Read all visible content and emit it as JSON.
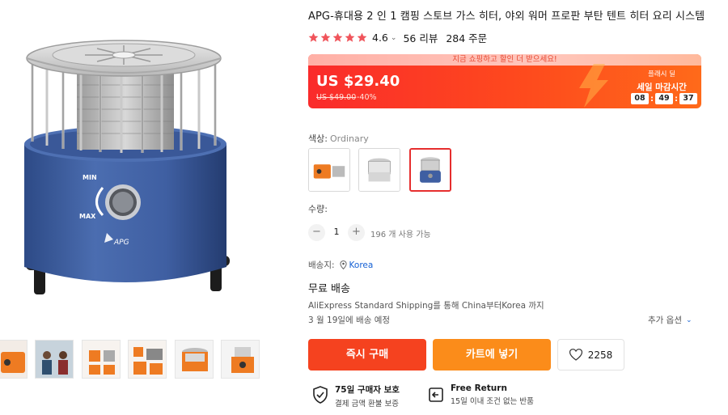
{
  "product": {
    "title": "APG-휴대용 2 인 1 캠핑 스토브 가스 히터, 야외 워머 프로판 부탄 텐트 히터 요리 시스템",
    "rating": "4.6",
    "stars": 5,
    "reviews": "56 리뷰",
    "orders": "284 주문"
  },
  "price": {
    "promo_banner": "지금 쇼핑하고 할인 더 받으세요!",
    "current": "US $29.40",
    "original": "US $49.00",
    "discount": "-40%",
    "flash_label": "플래시 딜",
    "flash_title": "세일 마감시간",
    "timer": {
      "h": "08",
      "m": "49",
      "s": "37"
    },
    "colors": {
      "start": "#fa2b2b",
      "end": "#ff6a1a"
    }
  },
  "color": {
    "label": "색상:",
    "selected": "Ordinary",
    "options": [
      "orange-heater",
      "silver-heater",
      "blue-heater"
    ]
  },
  "quantity": {
    "label": "수량:",
    "value": "1",
    "minus": "−",
    "plus": "+",
    "available": "196 개 사용 가능"
  },
  "shipping": {
    "label": "배송지:",
    "country": "Korea",
    "free": "무료 배송",
    "method": "AliExpress Standard Shipping를 통해 China부터Korea 까지",
    "date": "3 월 19일에 배송 예정",
    "more_options": "추가 옵션"
  },
  "actions": {
    "buy_now": "즉시 구매",
    "add_to_cart": "카트에 넣기",
    "wishlist_count": "2258"
  },
  "guarantees": [
    {
      "title": "75일 구매자 보호",
      "subtitle": "결제 금액 환불 보증",
      "icon": "shield-check-icon"
    },
    {
      "title": "Free Return",
      "subtitle": "15일 이내 조건 없는 반품",
      "icon": "return-icon"
    }
  ],
  "gallery": {
    "main_image": "blue-heater-photo",
    "heater_labels": {
      "min": "MIN",
      "max": "MAX",
      "brand": "APG"
    },
    "thumbnails": [
      "orange-heater-thumb",
      "campers-thumb",
      "orange-parts-thumb",
      "orange-stack-thumb",
      "orange-heater-top-thumb",
      "orange-heater-side-thumb"
    ]
  }
}
